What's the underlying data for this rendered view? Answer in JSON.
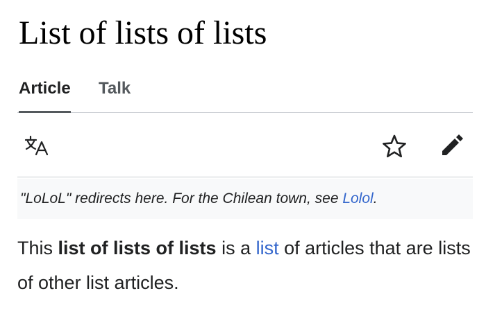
{
  "page": {
    "title": "List of lists of lists"
  },
  "tabs": [
    {
      "label": "Article",
      "active": true
    },
    {
      "label": "Talk",
      "active": false
    }
  ],
  "toolbar": {
    "icons": [
      "language-icon",
      "star-icon",
      "edit-pencil-icon"
    ]
  },
  "hatnote": {
    "prefix": "\"LoLoL\" redirects here. For the Chilean town, see ",
    "link_text": "Lolol",
    "suffix": "."
  },
  "lead": {
    "part1": "This ",
    "bold_term": "list of lists of lists",
    "part2": " is a ",
    "link_text": "list",
    "part3": " of articles that are lists of other list articles."
  },
  "colors": {
    "link": "#3366cc",
    "text": "#202122",
    "tab_inactive": "#54595d",
    "divider": "#c8ccd1",
    "hatnote_bg": "#f8f9fa"
  }
}
